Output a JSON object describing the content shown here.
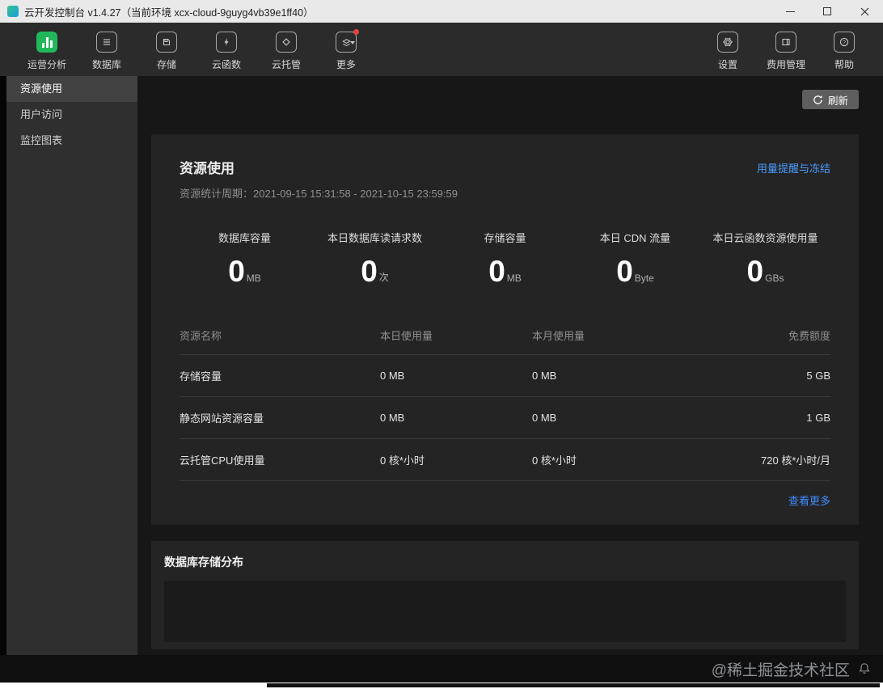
{
  "window": {
    "title": "云开发控制台 v1.4.27（当前环境 xcx-cloud-9guyg4vb39e1ff40）"
  },
  "toolbar": {
    "items": [
      {
        "label": "运营分析",
        "icon": "analytics-icon",
        "active": true
      },
      {
        "label": "数据库",
        "icon": "database-icon"
      },
      {
        "label": "存储",
        "icon": "storage-icon"
      },
      {
        "label": "云函数",
        "icon": "cloud-function-icon"
      },
      {
        "label": "云托管",
        "icon": "cloud-hosting-icon"
      },
      {
        "label": "更多",
        "icon": "more-layers-icon",
        "badge": true
      }
    ],
    "right": [
      {
        "label": "设置",
        "icon": "gear-icon"
      },
      {
        "label": "费用管理",
        "icon": "billing-icon"
      },
      {
        "label": "帮助",
        "icon": "help-icon"
      }
    ]
  },
  "sidebar": {
    "items": [
      {
        "label": "资源使用",
        "active": true
      },
      {
        "label": "用户访问",
        "active": false
      },
      {
        "label": "监控图表",
        "active": false
      }
    ]
  },
  "main": {
    "refresh_label": "刷新",
    "card": {
      "title": "资源使用",
      "period": "资源统计周期：2021-09-15 15:31:58 - 2021-10-15 23:59:59",
      "alert_link": "用量提醒与冻结",
      "stats": [
        {
          "label": "数据库容量",
          "value": "0",
          "unit": "MB"
        },
        {
          "label": "本日数据库读请求数",
          "value": "0",
          "unit": "次"
        },
        {
          "label": "存储容量",
          "value": "0",
          "unit": "MB"
        },
        {
          "label": "本日 CDN 流量",
          "value": "0",
          "unit": "Byte"
        },
        {
          "label": "本日云函数资源使用量",
          "value": "0",
          "unit": "GBs"
        }
      ],
      "table": {
        "headers": [
          "资源名称",
          "本日使用量",
          "本月使用量",
          "免费额度"
        ],
        "rows": [
          [
            "存储容量",
            "0 MB",
            "0 MB",
            "5 GB"
          ],
          [
            "静态网站资源容量",
            "0 MB",
            "0 MB",
            "1 GB"
          ],
          [
            "云托管CPU使用量",
            "0 核*小时",
            "0 核*小时",
            "720 核*小时/月"
          ]
        ]
      },
      "more_link": "查看更多"
    },
    "db_card": {
      "title": "数据库存储分布"
    }
  },
  "footer": {
    "watermark": "@稀土掘金技术社区"
  },
  "colors": {
    "accent_green": "#21b85c",
    "link_blue": "#4d9bff",
    "badge_red": "#e5433e"
  }
}
